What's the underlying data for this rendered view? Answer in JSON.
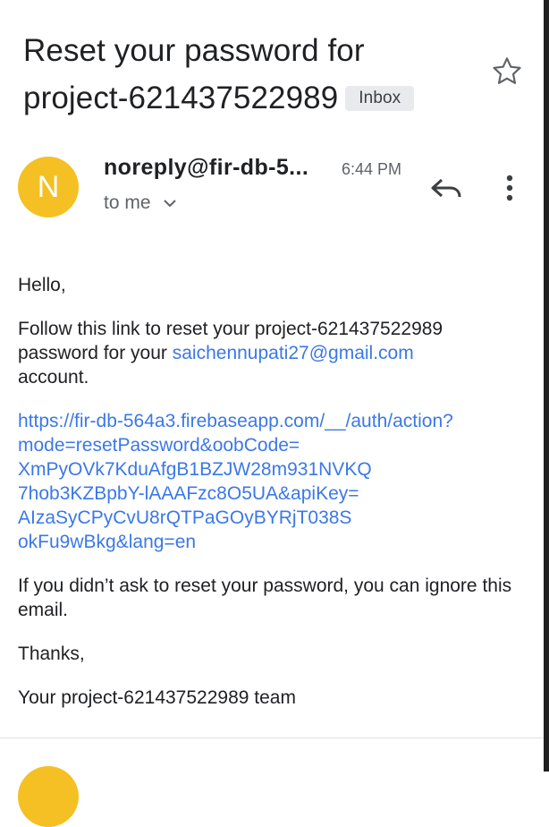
{
  "email": {
    "subject_line1": "Reset your password for",
    "subject_line2": "project-621437522989",
    "label_chip": "Inbox",
    "star_icon": "star-outline-icon",
    "sender": {
      "avatar_letter": "N",
      "avatar_color": "#f4c023",
      "address": "noreply@fir-db-5...",
      "time": "6:44 PM",
      "recipient": "to me",
      "recipient_chevron_icon": "chevron-down-icon",
      "reply_icon": "reply-icon",
      "more_icon": "more-vert-icon"
    },
    "body": {
      "greeting": "Hello,",
      "intro_before": "Follow this link to reset your project-621437522989 password for your ",
      "account_email": "saichennupati27@gmail.com",
      "intro_after": "account.",
      "reset_link_lines": [
        "https://fir-db-564a3.firebaseapp.com/__/auth/action?",
        "mode=resetPassword&oobCode=",
        "XmPyOVk7KduAfgB1BZJW28m931NVKQ",
        "7hob3KZBpbY-lAAAFzc8O5UA&apiKey=",
        "AIzaSyCPyCvU8rQTPaGOyBYRjT038S",
        "okFu9wBkg&lang=en"
      ],
      "ignore_note": "If you didn’t ask to reset your password, you can ignore this email.",
      "thanks": "Thanks,",
      "signature": "Your project-621437522989 team"
    }
  },
  "colors": {
    "link": "#3b78e7",
    "text": "#202124",
    "secondary_text": "#5f6368",
    "chip_bg": "#e8eaed"
  }
}
